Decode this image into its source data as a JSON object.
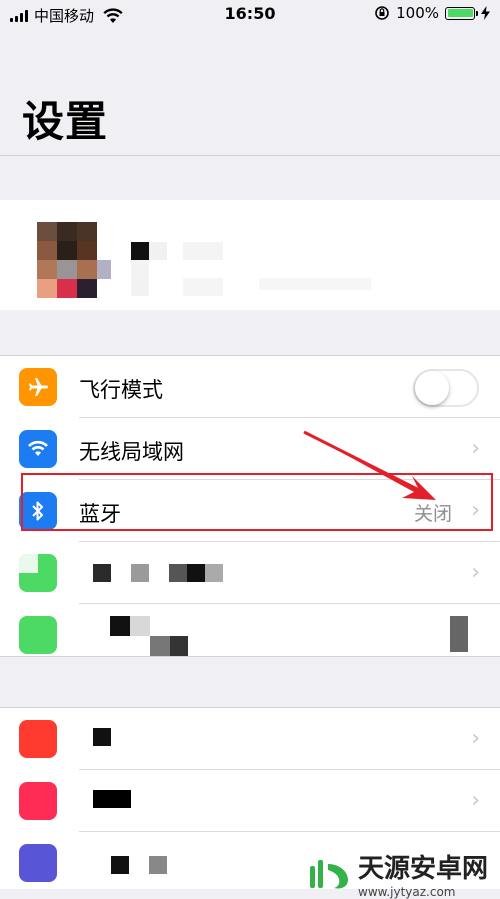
{
  "status_bar": {
    "carrier": "中国移动",
    "time": "16:50",
    "battery_percent": "100%",
    "battery_level": 1.0,
    "wifi_icon": "wifi-icon",
    "lock_icon": "rotation-lock-icon",
    "charging_icon": "charging-bolt-icon"
  },
  "header": {
    "title": "设置"
  },
  "settings": [
    {
      "label": "飞行模式",
      "icon": "airplane-icon",
      "icon_color": "#ff9500",
      "control": "toggle",
      "toggle_on": false
    },
    {
      "label": "无线局域网",
      "icon": "wifi-icon",
      "icon_color": "#1e7cf2",
      "control": "chevron"
    },
    {
      "label": "蓝牙",
      "icon": "bluetooth-icon",
      "icon_color": "#1e7cf2",
      "control": "chevron",
      "value": "关闭"
    }
  ],
  "chevron_symbol": "›",
  "colors": {
    "highlight": "#e3202a",
    "arrow": "#e3202a",
    "background": "#efeff4"
  },
  "watermark": {
    "title": "天源安卓网",
    "url": "www.jytyaz.com"
  }
}
